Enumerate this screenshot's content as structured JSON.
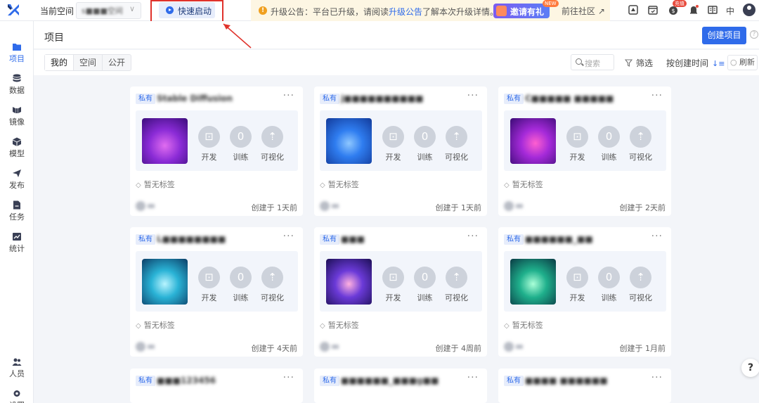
{
  "top": {
    "space_label": "当前空间",
    "space_value": "s■■■空间",
    "quick_start": "快速启动",
    "notice_prefix": "升级公告：平台已升级，请阅读",
    "notice_link": "升级公告",
    "notice_suffix": "了解本次升级详情。",
    "invite": "邀请有礼",
    "new_badge": "NEW",
    "community": "前往社区 ↗",
    "recharge_badge": "充值",
    "lang": "中"
  },
  "sidebar": {
    "items": [
      {
        "label": "项目",
        "icon": "folder-icon"
      },
      {
        "label": "数据",
        "icon": "database-icon"
      },
      {
        "label": "镜像",
        "icon": "image-icon"
      },
      {
        "label": "模型",
        "icon": "cube-icon"
      },
      {
        "label": "发布",
        "icon": "send-icon"
      },
      {
        "label": "任务",
        "icon": "task-icon"
      },
      {
        "label": "统计",
        "icon": "chart-icon"
      }
    ],
    "bottom": [
      {
        "label": "人员",
        "icon": "users-icon"
      },
      {
        "label": "设置",
        "icon": "settings-icon"
      }
    ]
  },
  "main": {
    "title": "项目",
    "create_button": "创建项目",
    "help": "?",
    "tabs": [
      "我的",
      "空间",
      "公开"
    ],
    "search_placeholder": "搜索",
    "filter": "筛选",
    "sort": "按创建时间",
    "refresh": "刷新"
  },
  "cards": [
    {
      "tag": "私有",
      "name": "Stable Diffusion",
      "dev": "开发",
      "train_count": "0",
      "train": "训练",
      "viz": "可视化",
      "tags": "暂无标签",
      "created": "创建于 1天前"
    },
    {
      "tag": "私有",
      "name": "j■■■■■■■■■■",
      "dev": "开发",
      "train_count": "0",
      "train": "训练",
      "viz": "可视化",
      "tags": "暂无标签",
      "created": "创建于 1天前"
    },
    {
      "tag": "私有",
      "name": "C■■■■■ ■■■■■",
      "dev": "开发",
      "train_count": "0",
      "train": "训练",
      "viz": "可视化",
      "tags": "暂无标签",
      "created": "创建于 2天前"
    },
    {
      "tag": "私有",
      "name": "L■■■■■■■■",
      "dev": "开发",
      "train_count": "0",
      "train": "训练",
      "viz": "可视化",
      "tags": "暂无标签",
      "created": "创建于 4天前"
    },
    {
      "tag": "私有",
      "name": "■■■",
      "dev": "开发",
      "train_count": "0",
      "train": "训练",
      "viz": "可视化",
      "tags": "暂无标签",
      "created": "创建于 4周前"
    },
    {
      "tag": "私有",
      "name": "■■■■■■_■■",
      "dev": "开发",
      "train_count": "0",
      "train": "训练",
      "viz": "可视化",
      "tags": "暂无标签",
      "created": "创建于 1月前"
    },
    {
      "tag": "私有",
      "name": "■■■123456",
      "dev": "",
      "train_count": "",
      "train": "",
      "viz": "",
      "tags": "",
      "created": ""
    },
    {
      "tag": "私有",
      "name": "■■■■■■_■■■g■■",
      "dev": "",
      "train_count": "",
      "train": "",
      "viz": "",
      "tags": "",
      "created": ""
    },
    {
      "tag": "私有",
      "name": "■■■■ ■■■■■■",
      "dev": "",
      "train_count": "",
      "train": "",
      "viz": "",
      "tags": "",
      "created": ""
    }
  ],
  "colors": {
    "accent": "#2f6bea",
    "highlight": "#e0322b",
    "notice_bg": "#fdf6e3"
  }
}
